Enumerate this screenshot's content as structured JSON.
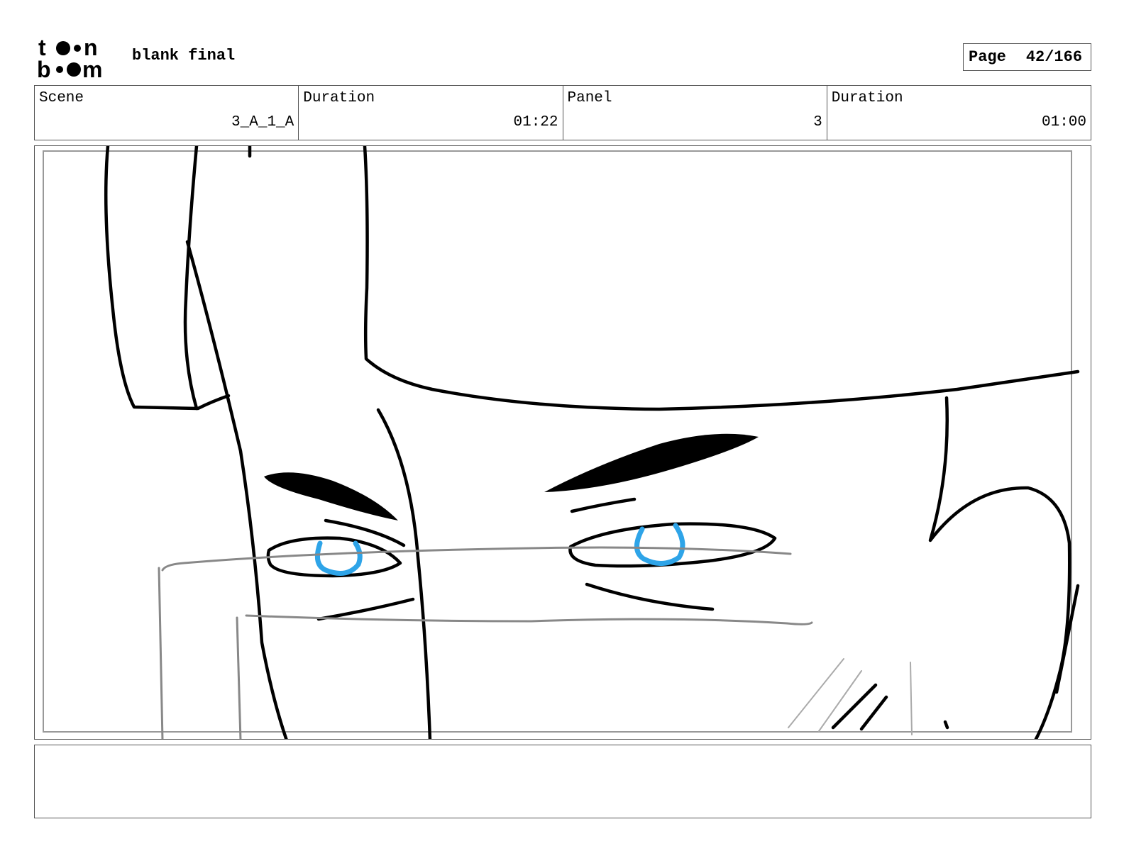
{
  "header": {
    "logo": "toon boom",
    "document_title": "blank final",
    "page_label": "Page",
    "page_number": "42/166"
  },
  "info": [
    {
      "label": "Scene",
      "value": "3_A_1_A"
    },
    {
      "label": "Duration",
      "value": "01:22"
    },
    {
      "label": "Panel",
      "value": "3"
    },
    {
      "label": "Duration",
      "value": "01:00"
    }
  ],
  "panel": {
    "content": "sketch",
    "accent_color": "#2ea4e8",
    "ink_color": "#000000",
    "guide_color": "#888888"
  },
  "notes": {
    "text": ""
  }
}
